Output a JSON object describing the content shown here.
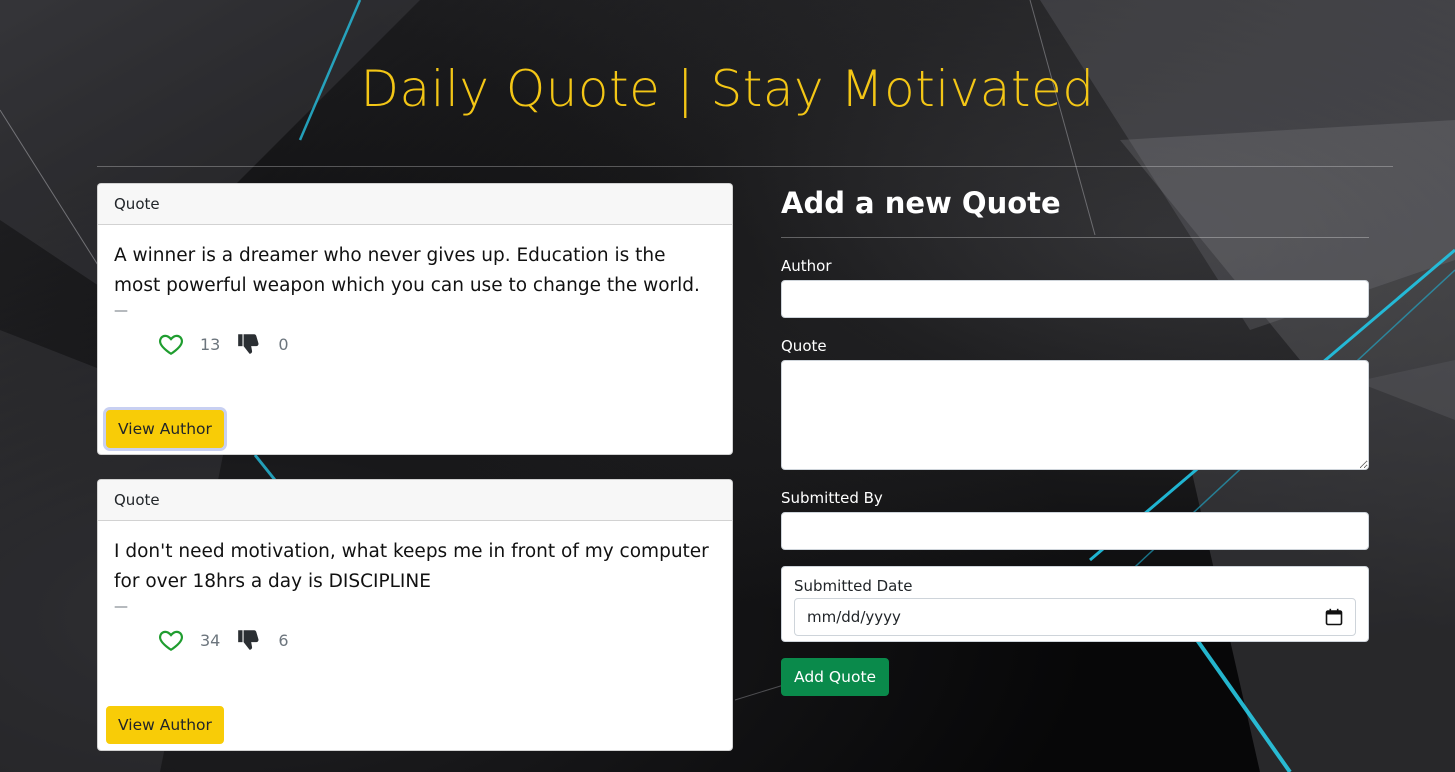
{
  "page": {
    "title": "Daily Quote | Stay Motivated"
  },
  "quotes": [
    {
      "header": "Quote",
      "text": "A winner is a dreamer who never gives up. Education is the most powerful weapon which you can use to change the world.",
      "dash": "—",
      "likes": "13",
      "dislikes": "0",
      "button_label": "View Author",
      "focused": true
    },
    {
      "header": "Quote",
      "text": "I don't need motivation, what keeps me in front of my computer for over 18hrs a day is DISCIPLINE",
      "dash": "—",
      "likes": "34",
      "dislikes": "6",
      "button_label": "View Author",
      "focused": false
    }
  ],
  "form": {
    "heading": "Add a new Quote",
    "author_label": "Author",
    "author_value": "",
    "quote_label": "Quote",
    "quote_value": "",
    "submitted_by_label": "Submitted By",
    "submitted_by_value": "",
    "submitted_date_label": "Submitted Date",
    "submitted_date_value": "mm/dd/yyyy",
    "submit_label": "Add Quote"
  },
  "icons": {
    "like": "heart-outline-icon",
    "dislike": "thumbs-down-icon",
    "calendar": "calendar-icon"
  },
  "colors": {
    "title": "#f3c616",
    "view_author_button": "#f8cc07",
    "add_quote_button": "#0a8a4b",
    "like_icon": "#1f9d2f",
    "dislike_icon": "#2b2f33"
  }
}
